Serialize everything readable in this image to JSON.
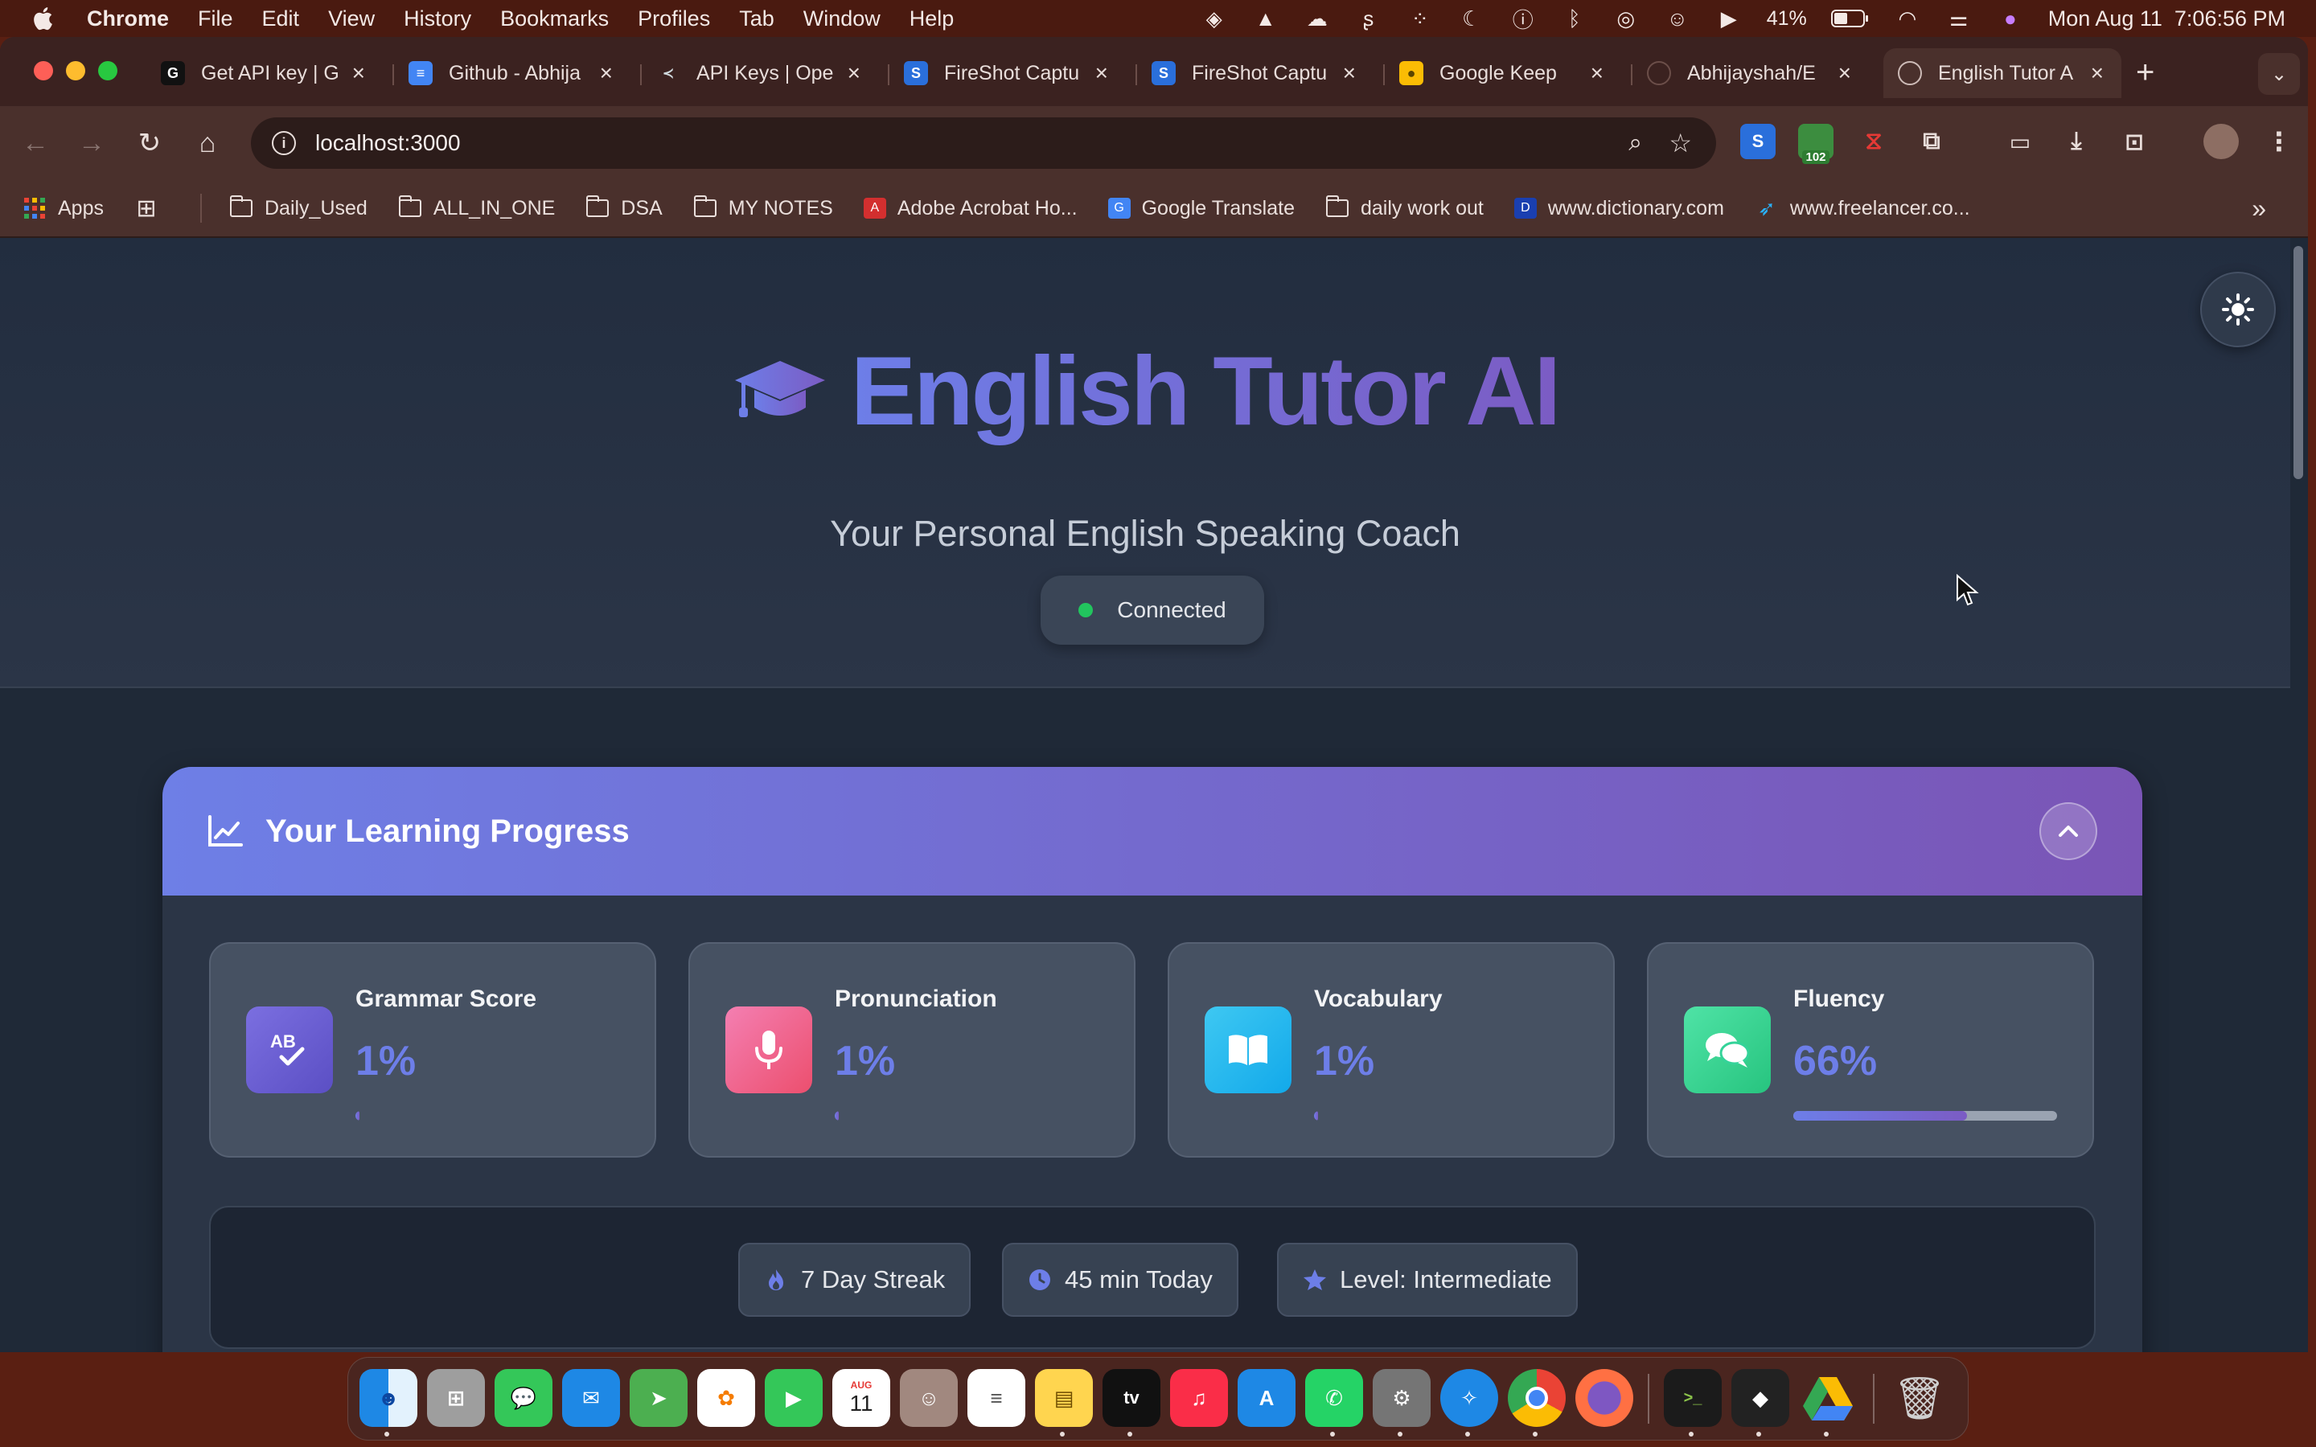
{
  "menubar": {
    "app": "Chrome",
    "items": [
      "File",
      "Edit",
      "View",
      "History",
      "Bookmarks",
      "Profiles",
      "Tab",
      "Window",
      "Help"
    ],
    "battery": "41%",
    "datetime": "Mon Aug 11  7:06:56 PM"
  },
  "tabs": [
    {
      "title": "Get API key | G",
      "icon": "openai-icon"
    },
    {
      "title": "Github - Abhija",
      "icon": "google-docs-icon"
    },
    {
      "title": "API Keys | Ope",
      "icon": "api-keys-icon"
    },
    {
      "title": "FireShot Captu",
      "icon": "fireshot-icon"
    },
    {
      "title": "FireShot Captu",
      "icon": "fireshot-icon"
    },
    {
      "title": "Google Keep",
      "icon": "google-keep-icon"
    },
    {
      "title": "Abhijayshah/E",
      "icon": "github-icon"
    },
    {
      "title": "English Tutor A",
      "icon": "globe-icon"
    }
  ],
  "omnibox": {
    "url": "localhost:3000"
  },
  "extensions": {
    "badge": "102"
  },
  "bookmarks": [
    {
      "label": "Apps",
      "icon": "apps-grid-icon"
    },
    {
      "label": "",
      "icon": "tab-groups-icon"
    },
    {
      "label": "Daily_Used",
      "icon": "folder-icon"
    },
    {
      "label": "ALL_IN_ONE",
      "icon": "folder-icon"
    },
    {
      "label": "DSA",
      "icon": "folder-icon"
    },
    {
      "label": "MY NOTES",
      "icon": "folder-icon"
    },
    {
      "label": "Adobe Acrobat Ho...",
      "icon": "adobe-icon"
    },
    {
      "label": "Google Translate",
      "icon": "translate-icon"
    },
    {
      "label": "daily work out",
      "icon": "folder-icon"
    },
    {
      "label": "www.dictionary.com",
      "icon": "dictionary-icon"
    },
    {
      "label": "www.freelancer.co...",
      "icon": "freelancer-icon"
    }
  ],
  "page": {
    "title": "English Tutor AI",
    "subtitle": "Your Personal English Speaking Coach",
    "status": "Connected",
    "progress": {
      "heading": "Your Learning Progress",
      "stats": [
        {
          "label": "Grammar Score",
          "value": "1%",
          "fraction": 0.01,
          "icon": "ab-check-icon",
          "color": "#6d5fd3"
        },
        {
          "label": "Pronunciation",
          "value": "1%",
          "fraction": 0.01,
          "icon": "microphone-icon",
          "color": "#ef5f8a"
        },
        {
          "label": "Vocabulary",
          "value": "1%",
          "fraction": 0.01,
          "icon": "book-icon",
          "color": "#22b8ee"
        },
        {
          "label": "Fluency",
          "value": "66%",
          "fraction": 0.66,
          "icon": "chat-bubbles-icon",
          "color": "#34d399"
        }
      ],
      "pills": [
        {
          "label": "7 Day Streak",
          "icon": "flame-icon"
        },
        {
          "label": "45 min Today",
          "icon": "clock-icon"
        },
        {
          "label": "Level: Intermediate",
          "icon": "star-icon"
        }
      ]
    }
  },
  "dock": {
    "calendar_month": "AUG",
    "calendar_day": "11",
    "apps": [
      "Finder",
      "Launchpad",
      "Messages",
      "Mail",
      "Maps",
      "Photos",
      "FaceTime",
      "Calendar",
      "Contacts",
      "Reminders",
      "Notes",
      "TV",
      "Music",
      "App Store",
      "WhatsApp",
      "System Settings",
      "Safari",
      "Chrome",
      "Firefox",
      "Terminal",
      "Cursor",
      "Google Drive",
      "Trash"
    ]
  }
}
